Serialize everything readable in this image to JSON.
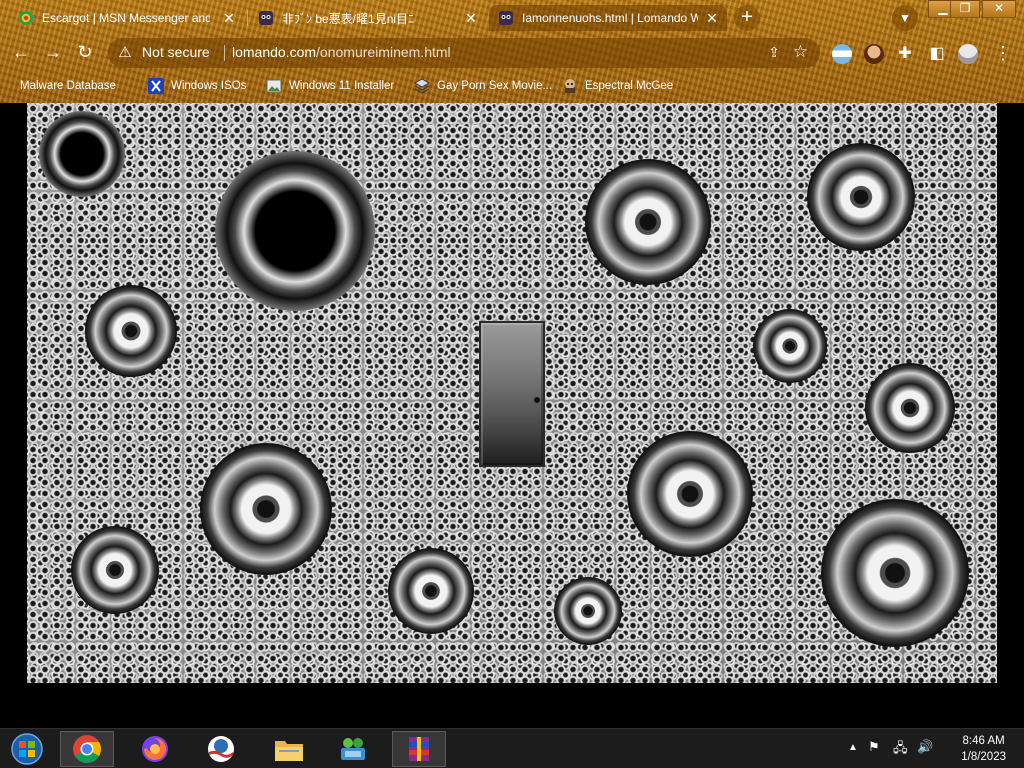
{
  "tabs": [
    {
      "label": "Escargot | MSN Messenger and W",
      "icon": "escargot-favicon",
      "active": false
    },
    {
      "label": "非ﾌﾞﾝ be悪表/曜1見ni目ﾆ",
      "icon": "character-favicon",
      "active": false
    },
    {
      "label": "Iamonnenuohs.html | Lomando Wi",
      "icon": "character-favicon",
      "active": true
    }
  ],
  "toolbar": {
    "security_label": "Not secure",
    "url_domain": "lomando.com",
    "url_path": "/onomureiminem.html"
  },
  "bookmarks": [
    {
      "label": "Malware Database",
      "icon": "folder-icon"
    },
    {
      "label": "Windows ISOs",
      "icon": "x-logo-icon"
    },
    {
      "label": "Windows 11 Installer",
      "icon": "image-icon"
    },
    {
      "label": "Gay Porn Sex Movie...",
      "icon": "stack-icon"
    },
    {
      "label": "Espectral McGee",
      "icon": "character-icon"
    }
  ],
  "window_controls": {
    "minimize": "▁",
    "restore": "❐",
    "close": "✕"
  },
  "taskbar": {
    "apps": [
      "windows-start",
      "chrome",
      "firefox",
      "obama-logo",
      "file-explorer",
      "network-people",
      "winrar"
    ],
    "clock_time": "8:46 AM",
    "clock_date": "1/8/2023"
  }
}
